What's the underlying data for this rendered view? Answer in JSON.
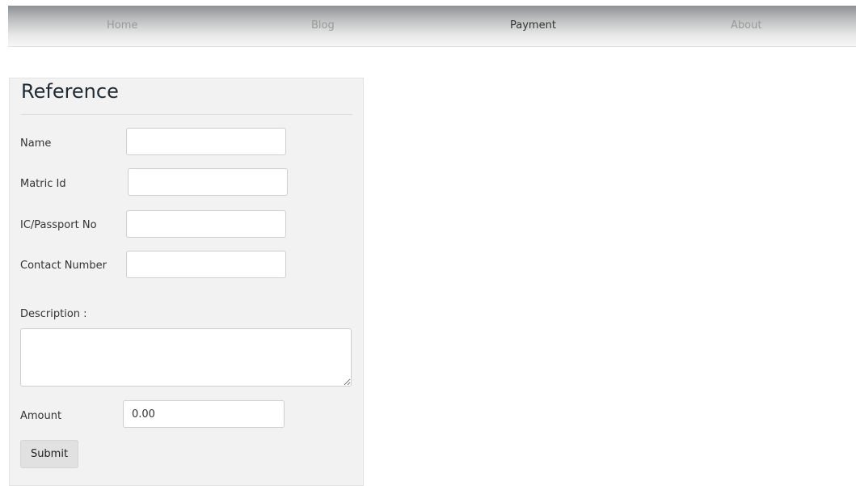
{
  "nav": {
    "items": [
      {
        "label": "Home"
      },
      {
        "label": "Blog"
      },
      {
        "label": "Payment",
        "active": true
      },
      {
        "label": "About"
      }
    ]
  },
  "form": {
    "title": "Reference",
    "name": {
      "label": "Name",
      "value": ""
    },
    "matric": {
      "label": "Matric Id",
      "value": ""
    },
    "ic": {
      "label": "IC/Passport No",
      "value": ""
    },
    "contact": {
      "label": "Contact Number",
      "value": ""
    },
    "description": {
      "label": "Description :",
      "value": ""
    },
    "amount": {
      "label": "Amount",
      "value": "0.00"
    },
    "submit_label": "Submit"
  }
}
